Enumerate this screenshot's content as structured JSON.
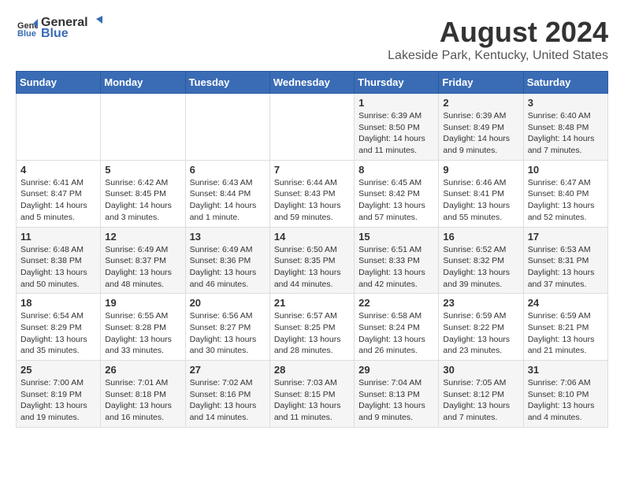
{
  "logo": {
    "general": "General",
    "blue": "Blue"
  },
  "title": "August 2024",
  "subtitle": "Lakeside Park, Kentucky, United States",
  "headers": [
    "Sunday",
    "Monday",
    "Tuesday",
    "Wednesday",
    "Thursday",
    "Friday",
    "Saturday"
  ],
  "weeks": [
    [
      {
        "day": "",
        "info": ""
      },
      {
        "day": "",
        "info": ""
      },
      {
        "day": "",
        "info": ""
      },
      {
        "day": "",
        "info": ""
      },
      {
        "day": "1",
        "info": "Sunrise: 6:39 AM\nSunset: 8:50 PM\nDaylight: 14 hours and 11 minutes."
      },
      {
        "day": "2",
        "info": "Sunrise: 6:39 AM\nSunset: 8:49 PM\nDaylight: 14 hours and 9 minutes."
      },
      {
        "day": "3",
        "info": "Sunrise: 6:40 AM\nSunset: 8:48 PM\nDaylight: 14 hours and 7 minutes."
      }
    ],
    [
      {
        "day": "4",
        "info": "Sunrise: 6:41 AM\nSunset: 8:47 PM\nDaylight: 14 hours and 5 minutes."
      },
      {
        "day": "5",
        "info": "Sunrise: 6:42 AM\nSunset: 8:45 PM\nDaylight: 14 hours and 3 minutes."
      },
      {
        "day": "6",
        "info": "Sunrise: 6:43 AM\nSunset: 8:44 PM\nDaylight: 14 hours and 1 minute."
      },
      {
        "day": "7",
        "info": "Sunrise: 6:44 AM\nSunset: 8:43 PM\nDaylight: 13 hours and 59 minutes."
      },
      {
        "day": "8",
        "info": "Sunrise: 6:45 AM\nSunset: 8:42 PM\nDaylight: 13 hours and 57 minutes."
      },
      {
        "day": "9",
        "info": "Sunrise: 6:46 AM\nSunset: 8:41 PM\nDaylight: 13 hours and 55 minutes."
      },
      {
        "day": "10",
        "info": "Sunrise: 6:47 AM\nSunset: 8:40 PM\nDaylight: 13 hours and 52 minutes."
      }
    ],
    [
      {
        "day": "11",
        "info": "Sunrise: 6:48 AM\nSunset: 8:38 PM\nDaylight: 13 hours and 50 minutes."
      },
      {
        "day": "12",
        "info": "Sunrise: 6:49 AM\nSunset: 8:37 PM\nDaylight: 13 hours and 48 minutes."
      },
      {
        "day": "13",
        "info": "Sunrise: 6:49 AM\nSunset: 8:36 PM\nDaylight: 13 hours and 46 minutes."
      },
      {
        "day": "14",
        "info": "Sunrise: 6:50 AM\nSunset: 8:35 PM\nDaylight: 13 hours and 44 minutes."
      },
      {
        "day": "15",
        "info": "Sunrise: 6:51 AM\nSunset: 8:33 PM\nDaylight: 13 hours and 42 minutes."
      },
      {
        "day": "16",
        "info": "Sunrise: 6:52 AM\nSunset: 8:32 PM\nDaylight: 13 hours and 39 minutes."
      },
      {
        "day": "17",
        "info": "Sunrise: 6:53 AM\nSunset: 8:31 PM\nDaylight: 13 hours and 37 minutes."
      }
    ],
    [
      {
        "day": "18",
        "info": "Sunrise: 6:54 AM\nSunset: 8:29 PM\nDaylight: 13 hours and 35 minutes."
      },
      {
        "day": "19",
        "info": "Sunrise: 6:55 AM\nSunset: 8:28 PM\nDaylight: 13 hours and 33 minutes."
      },
      {
        "day": "20",
        "info": "Sunrise: 6:56 AM\nSunset: 8:27 PM\nDaylight: 13 hours and 30 minutes."
      },
      {
        "day": "21",
        "info": "Sunrise: 6:57 AM\nSunset: 8:25 PM\nDaylight: 13 hours and 28 minutes."
      },
      {
        "day": "22",
        "info": "Sunrise: 6:58 AM\nSunset: 8:24 PM\nDaylight: 13 hours and 26 minutes."
      },
      {
        "day": "23",
        "info": "Sunrise: 6:59 AM\nSunset: 8:22 PM\nDaylight: 13 hours and 23 minutes."
      },
      {
        "day": "24",
        "info": "Sunrise: 6:59 AM\nSunset: 8:21 PM\nDaylight: 13 hours and 21 minutes."
      }
    ],
    [
      {
        "day": "25",
        "info": "Sunrise: 7:00 AM\nSunset: 8:19 PM\nDaylight: 13 hours and 19 minutes."
      },
      {
        "day": "26",
        "info": "Sunrise: 7:01 AM\nSunset: 8:18 PM\nDaylight: 13 hours and 16 minutes."
      },
      {
        "day": "27",
        "info": "Sunrise: 7:02 AM\nSunset: 8:16 PM\nDaylight: 13 hours and 14 minutes."
      },
      {
        "day": "28",
        "info": "Sunrise: 7:03 AM\nSunset: 8:15 PM\nDaylight: 13 hours and 11 minutes."
      },
      {
        "day": "29",
        "info": "Sunrise: 7:04 AM\nSunset: 8:13 PM\nDaylight: 13 hours and 9 minutes."
      },
      {
        "day": "30",
        "info": "Sunrise: 7:05 AM\nSunset: 8:12 PM\nDaylight: 13 hours and 7 minutes."
      },
      {
        "day": "31",
        "info": "Sunrise: 7:06 AM\nSunset: 8:10 PM\nDaylight: 13 hours and 4 minutes."
      }
    ]
  ]
}
